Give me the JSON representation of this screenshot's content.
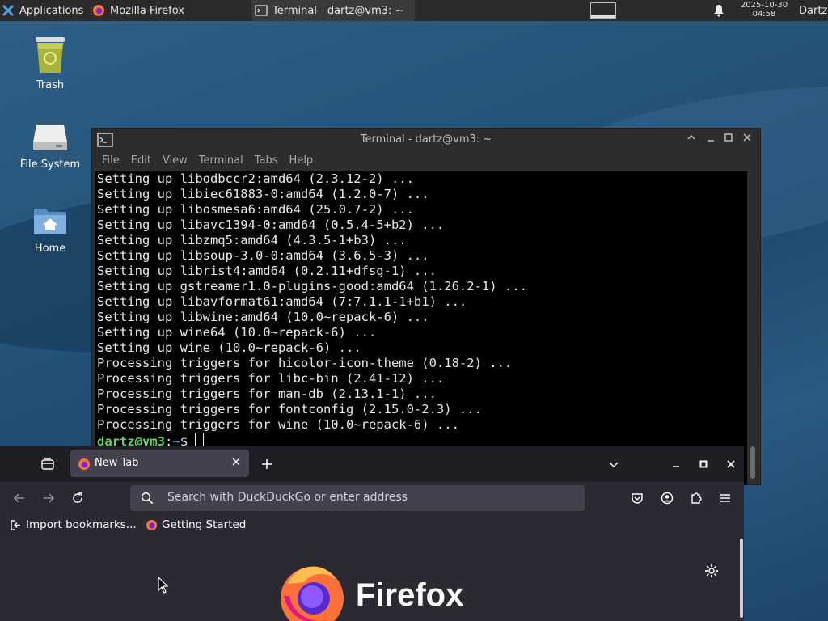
{
  "panel": {
    "applications_label": "Applications",
    "tasks": [
      {
        "label": "Mozilla Firefox",
        "icon": "firefox-icon"
      },
      {
        "label": "Terminal - dartz@vm3: ~",
        "icon": "terminal-icon"
      }
    ],
    "clock_date": "2025-10-30",
    "clock_time": "04:58",
    "user": "Dartz"
  },
  "desktop": {
    "icons": [
      {
        "label": "Trash",
        "icon": "trash-icon"
      },
      {
        "label": "File System",
        "icon": "drive-icon"
      },
      {
        "label": "Home",
        "icon": "home-folder-icon"
      }
    ]
  },
  "terminal": {
    "title": "Terminal - dartz@vm3: ~",
    "menu": [
      "File",
      "Edit",
      "View",
      "Terminal",
      "Tabs",
      "Help"
    ],
    "lines": [
      "Setting up libodbccr2:amd64 (2.3.12-2) ...",
      "Setting up libiec61883-0:amd64 (1.2.0-7) ...",
      "Setting up libosmesa6:amd64 (25.0.7-2) ...",
      "Setting up libavc1394-0:amd64 (0.5.4-5+b2) ...",
      "Setting up libzmq5:amd64 (4.3.5-1+b3) ...",
      "Setting up libsoup-3.0-0:amd64 (3.6.5-3) ...",
      "Setting up librist4:amd64 (0.2.11+dfsg-1) ...",
      "Setting up gstreamer1.0-plugins-good:amd64 (1.26.2-1) ...",
      "Setting up libavformat61:amd64 (7:7.1.1-1+b1) ...",
      "Setting up libwine:amd64 (10.0~repack-6) ...",
      "Setting up wine64 (10.0~repack-6) ...",
      "Setting up wine (10.0~repack-6) ...",
      "Processing triggers for hicolor-icon-theme (0.18-2) ...",
      "Processing triggers for libc-bin (2.41-12) ...",
      "Processing triggers for man-db (2.13.1-1) ...",
      "Processing triggers for fontconfig (2.15.0-2.3) ...",
      "Processing triggers for wine (10.0~repack-6) ..."
    ],
    "prompt_user": "dartz@vm3",
    "prompt_sep": ":",
    "prompt_path": "~",
    "prompt_symbol": "$ "
  },
  "firefox": {
    "tab_label": "New Tab",
    "url_placeholder": "Search with DuckDuckGo or enter address",
    "bookmarks": [
      {
        "label": "Import bookmarks...",
        "icon": "import-icon"
      },
      {
        "label": "Getting Started",
        "icon": "firefox-icon"
      }
    ],
    "brand": "Firefox"
  }
}
